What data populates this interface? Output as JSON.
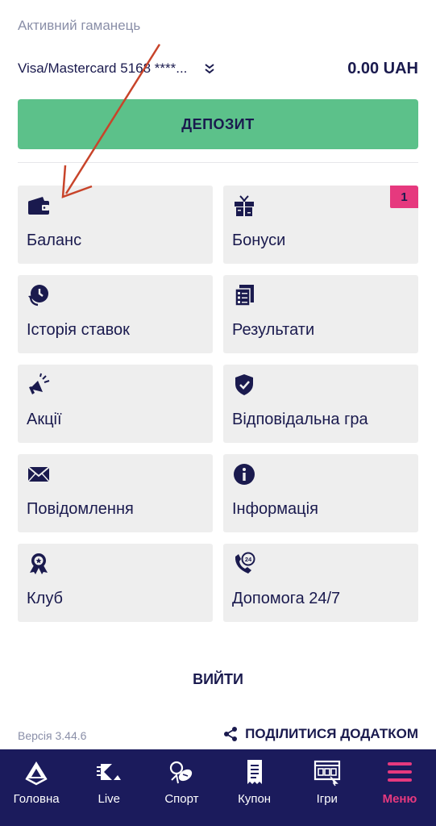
{
  "wallet": {
    "label": "Активний гаманець",
    "card": "Visa/Mastercard 5168 ****...",
    "balance": "0.00 UAH"
  },
  "deposit_label": "ДЕПОЗИТ",
  "tiles": [
    {
      "label": "Баланс",
      "icon": "wallet-icon"
    },
    {
      "label": "Бонуси",
      "icon": "gift-icon",
      "badge": "1"
    },
    {
      "label": "Історія ставок",
      "icon": "history-icon"
    },
    {
      "label": "Результати",
      "icon": "results-icon"
    },
    {
      "label": "Акції",
      "icon": "megaphone-icon"
    },
    {
      "label": "Відповідальна гра",
      "icon": "shield-check-icon"
    },
    {
      "label": "Повідомлення",
      "icon": "envelope-icon"
    },
    {
      "label": "Інформація",
      "icon": "info-icon"
    },
    {
      "label": "Клуб",
      "icon": "award-icon"
    },
    {
      "label": "Допомога 24/7",
      "icon": "phone-24-icon"
    }
  ],
  "logout_label": "ВИЙТИ",
  "version": "Версія 3.44.6",
  "share_label": "ПОДІЛИТИСЯ ДОДАТКОМ",
  "nav": [
    {
      "label": "Головна",
      "icon": "home-icon"
    },
    {
      "label": "Live",
      "icon": "live-icon"
    },
    {
      "label": "Спорт",
      "icon": "sport-icon"
    },
    {
      "label": "Купон",
      "icon": "coupon-icon"
    },
    {
      "label": "Ігри",
      "icon": "games-icon"
    },
    {
      "label": "Меню",
      "icon": "menu-icon",
      "active": true
    }
  ],
  "colors": {
    "navy": "#1a1a4e",
    "nav_bg": "#1b1b5c",
    "deposit_green": "#5cc18a",
    "accent_pink": "#e6397e",
    "tile_bg": "#eeeeee",
    "annotation_arrow": "#c8442a"
  }
}
